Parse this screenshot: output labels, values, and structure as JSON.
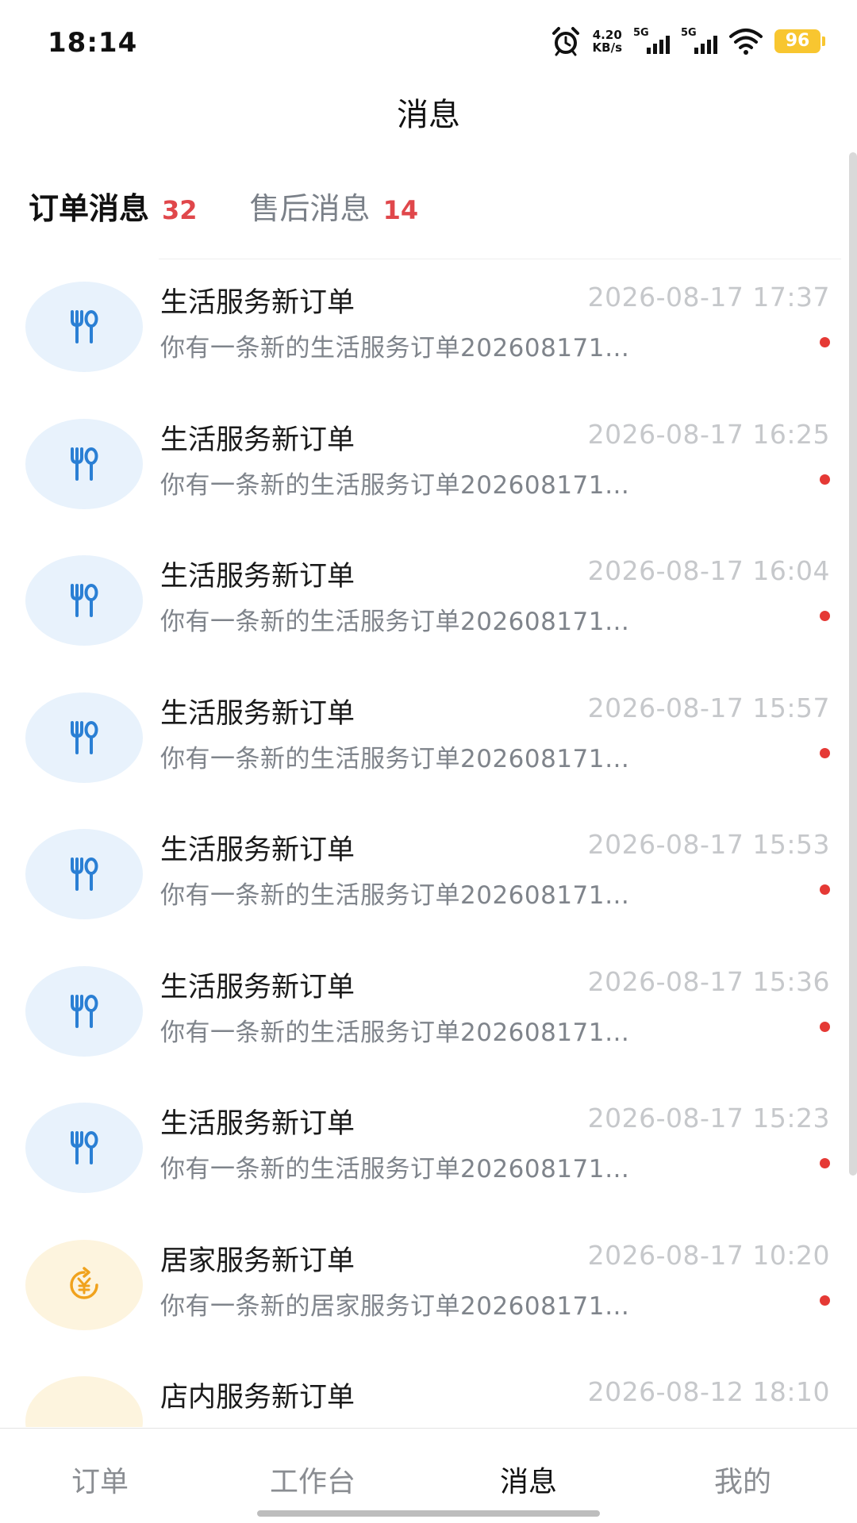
{
  "status_bar": {
    "time": "18:14",
    "net_speed_value": "4.20",
    "net_speed_unit": "KB/s",
    "sim1_label": "5G",
    "sim2_label": "5G",
    "battery": "96",
    "battery_color": "#f8c630"
  },
  "header": {
    "title": "消息"
  },
  "tabs": [
    {
      "label": "订单消息",
      "count": "32",
      "active": true
    },
    {
      "label": "售后消息",
      "count": "14",
      "active": false
    }
  ],
  "messages": [
    {
      "icon": "cutlery-icon",
      "title": "生活服务新订单",
      "time": "2026-08-17 17:37",
      "preview": "你有一条新的生活服务订单202608171…",
      "unread": true
    },
    {
      "icon": "cutlery-icon",
      "title": "生活服务新订单",
      "time": "2026-08-17 16:25",
      "preview": "你有一条新的生活服务订单202608171…",
      "unread": true
    },
    {
      "icon": "cutlery-icon",
      "title": "生活服务新订单",
      "time": "2026-08-17 16:04",
      "preview": "你有一条新的生活服务订单202608171…",
      "unread": true
    },
    {
      "icon": "cutlery-icon",
      "title": "生活服务新订单",
      "time": "2026-08-17 15:57",
      "preview": "你有一条新的生活服务订单202608171…",
      "unread": true
    },
    {
      "icon": "cutlery-icon",
      "title": "生活服务新订单",
      "time": "2026-08-17 15:53",
      "preview": "你有一条新的生活服务订单202608171…",
      "unread": true
    },
    {
      "icon": "cutlery-icon",
      "title": "生活服务新订单",
      "time": "2026-08-17 15:36",
      "preview": "你有一条新的生活服务订单202608171…",
      "unread": true
    },
    {
      "icon": "cutlery-icon",
      "title": "生活服务新订单",
      "time": "2026-08-17 15:23",
      "preview": "你有一条新的生活服务订单202608171…",
      "unread": true
    },
    {
      "icon": "yuan-refresh-icon",
      "title": "居家服务新订单",
      "time": "2026-08-17 10:20",
      "preview": "你有一条新的居家服务订单202608171…",
      "unread": true
    },
    {
      "icon": "store-icon",
      "title": "店内服务新订单",
      "time": "2026-08-12 18:10",
      "preview": "",
      "unread": false
    }
  ],
  "bottom_nav": [
    {
      "label": "订单",
      "active": false
    },
    {
      "label": "工作台",
      "active": false
    },
    {
      "label": "消息",
      "active": true
    },
    {
      "label": "我的",
      "active": false
    }
  ],
  "colors": {
    "accent_blue": "#2a7fd4",
    "accent_orange": "#f0a21d",
    "unread_red": "#e53935",
    "count_red": "#e0474b"
  }
}
